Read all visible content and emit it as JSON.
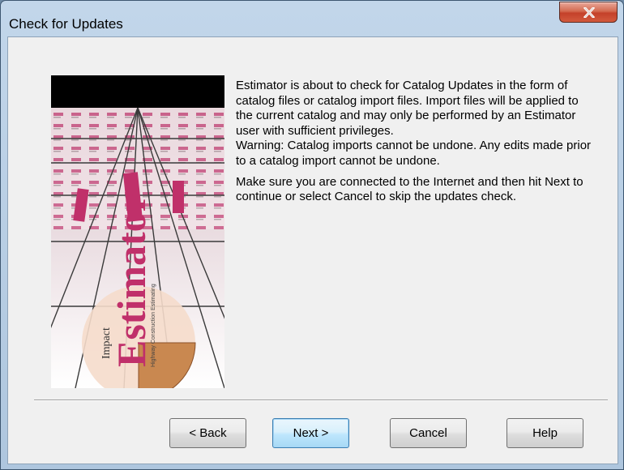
{
  "window": {
    "title": "Check for Updates",
    "close_icon": "close-icon"
  },
  "image": {
    "brand_text": "Estimator",
    "small_text": "Impact",
    "subtitle_text": "Highway Construction Estimating"
  },
  "content": {
    "paragraph1": "Estimator is about to check for Catalog Updates in the form of catalog files or catalog import files. Import files will be applied to the current catalog and may only be performed by an Estimator user with sufficient privileges.",
    "paragraph2": "Warning:  Catalog imports cannot be undone.  Any edits made prior to a catalog import cannot be undone.",
    "paragraph3": "Make sure you are connected to the Internet and then hit Next to continue or select Cancel to skip the updates check."
  },
  "buttons": {
    "back": "< Back",
    "next": "Next >",
    "cancel": "Cancel",
    "help": "Help"
  }
}
